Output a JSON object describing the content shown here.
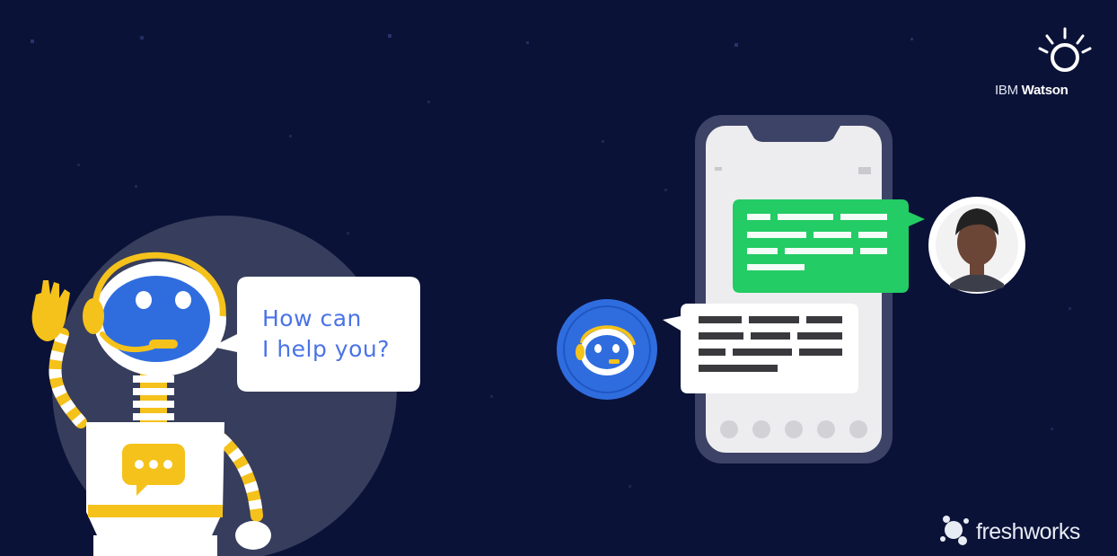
{
  "speech_bubble": {
    "line1": "How can",
    "line2": "I help you?"
  },
  "ibm_logo": {
    "prefix": "IBM",
    "name": "Watson",
    "icon": "ibm-watson-avatar-icon"
  },
  "freshworks_logo": {
    "name": "freshworks",
    "icon": "freshworks-icon"
  },
  "icons": {
    "robot": "robot-mascot-icon",
    "chatbot_avatar": "chatbot-avatar-icon",
    "user_avatar": "user-avatar-icon",
    "phone": "smartphone-icon",
    "chat_icon": "chat-bubble-icon"
  },
  "colors": {
    "background": "#0b1238",
    "robot_blue": "#2f6ddf",
    "robot_yellow": "#f5c21b",
    "user_message_green": "#23cc64",
    "bot_message_white": "#ffffff",
    "speech_text_blue": "#4a73e6"
  }
}
